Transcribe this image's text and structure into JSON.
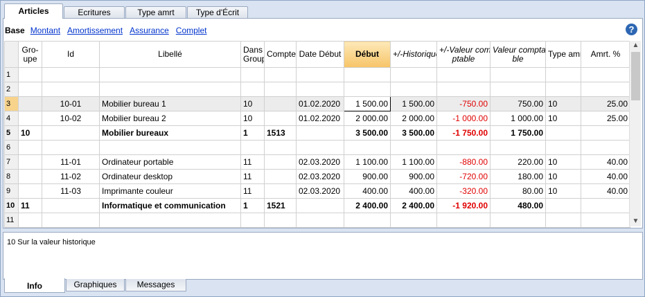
{
  "tabs": [
    {
      "label": "Articles",
      "active": true
    },
    {
      "label": "Ecritures",
      "active": false
    },
    {
      "label": "Type amrt",
      "active": false
    },
    {
      "label": "Type d'Écrit",
      "active": false
    }
  ],
  "views": {
    "base": "Base",
    "links": [
      "Montant",
      "Amortissement",
      "Assurance",
      "Complet"
    ]
  },
  "help_icon": "?",
  "columns": [
    "",
    "Gro-\nupe",
    "Id",
    "Libellé",
    "Dans\nGroup",
    "Compte",
    "Date Début",
    "Début",
    "+/-Historique",
    "+/-Valeur com-\nptable",
    "Valeur compta-\nble",
    "Type amrt",
    "Amrt. %"
  ],
  "rows": [
    {
      "n": "1",
      "cells": [
        "",
        "",
        "",
        "",
        "",
        "",
        "",
        "",
        "",
        "",
        "",
        ""
      ]
    },
    {
      "n": "2",
      "cells": [
        "",
        "",
        "",
        "",
        "",
        "",
        "",
        "",
        "",
        "",
        "",
        ""
      ]
    },
    {
      "n": "3",
      "cells": [
        "",
        "10-01",
        "Mobilier bureau 1",
        "10",
        "",
        "01.02.2020",
        "1 500.00",
        "1 500.00",
        "-750.00",
        "750.00",
        "10",
        "25.00"
      ]
    },
    {
      "n": "4",
      "cells": [
        "",
        "10-02",
        "Mobilier bureau 2",
        "10",
        "",
        "01.02.2020",
        "2 000.00",
        "2 000.00",
        "-1 000.00",
        "1 000.00",
        "10",
        "25.00"
      ]
    },
    {
      "n": "5",
      "cells": [
        "10",
        "",
        "Mobilier bureaux",
        "1",
        "1513",
        "",
        "3 500.00",
        "3 500.00",
        "-1 750.00",
        "1 750.00",
        "",
        ""
      ]
    },
    {
      "n": "6",
      "cells": [
        "",
        "",
        "",
        "",
        "",
        "",
        "",
        "",
        "",
        "",
        "",
        ""
      ]
    },
    {
      "n": "7",
      "cells": [
        "",
        "11-01",
        "Ordinateur portable",
        "11",
        "",
        "02.03.2020",
        "1 100.00",
        "1 100.00",
        "-880.00",
        "220.00",
        "10",
        "40.00"
      ]
    },
    {
      "n": "8",
      "cells": [
        "",
        "11-02",
        "Ordinateur desktop",
        "11",
        "",
        "02.03.2020",
        "900.00",
        "900.00",
        "-720.00",
        "180.00",
        "10",
        "40.00"
      ]
    },
    {
      "n": "9",
      "cells": [
        "",
        "11-03",
        "Imprimante couleur",
        "11",
        "",
        "02.03.2020",
        "400.00",
        "400.00",
        "-320.00",
        "80.00",
        "10",
        "40.00"
      ]
    },
    {
      "n": "10",
      "cells": [
        "11",
        "",
        "Informatique et communication",
        "1",
        "1521",
        "",
        "2 400.00",
        "2 400.00",
        "-1 920.00",
        "480.00",
        "",
        ""
      ]
    },
    {
      "n": "11",
      "cells": [
        "",
        "",
        "",
        "",
        "",
        "",
        "",
        "",
        "",
        "",
        "",
        ""
      ]
    }
  ],
  "info_text": "10 Sur la valeur historique",
  "bottom_tabs": [
    {
      "label": "Info",
      "active": true
    },
    {
      "label": "Graphiques",
      "active": false
    },
    {
      "label": "Messages",
      "active": false
    }
  ],
  "colors": {
    "accent": "#f7c468",
    "negative": "#e00000",
    "link": "#0033cc"
  }
}
